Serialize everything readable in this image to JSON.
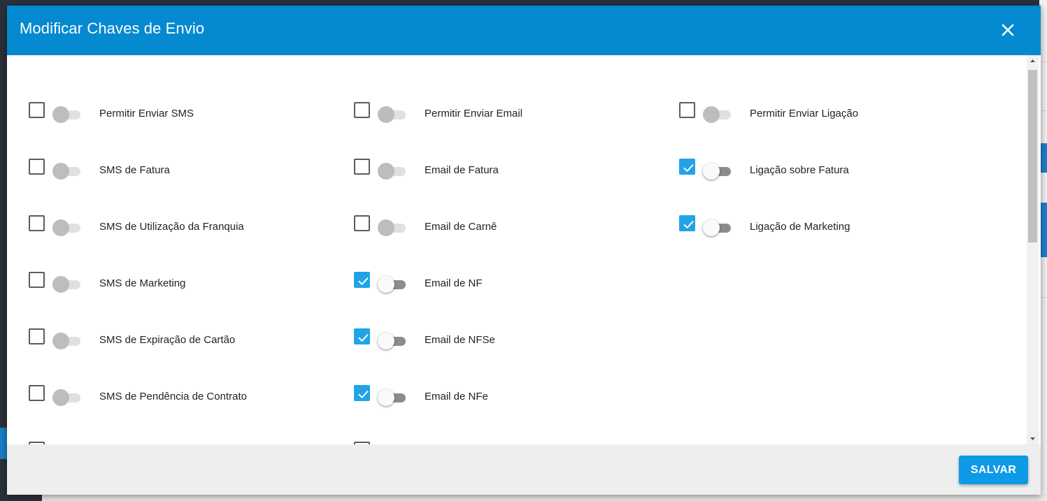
{
  "dialog": {
    "title": "Modificar Chaves de Envio",
    "close_icon": "close-icon",
    "save_label": "SALVAR"
  },
  "colors": {
    "header": "#0589d0",
    "checkbox_checked": "#22a3e6",
    "save_button": "#0d9ae6"
  },
  "sms": [
    {
      "label": "Permitir Enviar SMS",
      "checked": false,
      "toggle_on": false
    },
    {
      "label": "SMS de Fatura",
      "checked": false,
      "toggle_on": false
    },
    {
      "label": "SMS de Utilização da Franquia",
      "checked": false,
      "toggle_on": false
    },
    {
      "label": "SMS de Marketing",
      "checked": false,
      "toggle_on": false
    },
    {
      "label": "SMS de Expiração de Cartão",
      "checked": false,
      "toggle_on": false
    },
    {
      "label": "SMS de Pendência de Contrato",
      "checked": false,
      "toggle_on": false
    }
  ],
  "email": [
    {
      "label": "Permitir Enviar Email",
      "checked": false,
      "toggle_on": false
    },
    {
      "label": "Email de Fatura",
      "checked": false,
      "toggle_on": false
    },
    {
      "label": "Email de Carnê",
      "checked": false,
      "toggle_on": false
    },
    {
      "label": "Email de NF",
      "checked": true,
      "toggle_on": false
    },
    {
      "label": "Email de NFSe",
      "checked": true,
      "toggle_on": false
    },
    {
      "label": "Email de NFe",
      "checked": true,
      "toggle_on": false
    }
  ],
  "ligacao": [
    {
      "label": "Permitir Enviar Ligação",
      "checked": false,
      "toggle_on": false
    },
    {
      "label": "Ligação sobre Fatura",
      "checked": true,
      "toggle_on": false
    },
    {
      "label": "Ligação de Marketing",
      "checked": true,
      "toggle_on": false
    }
  ]
}
